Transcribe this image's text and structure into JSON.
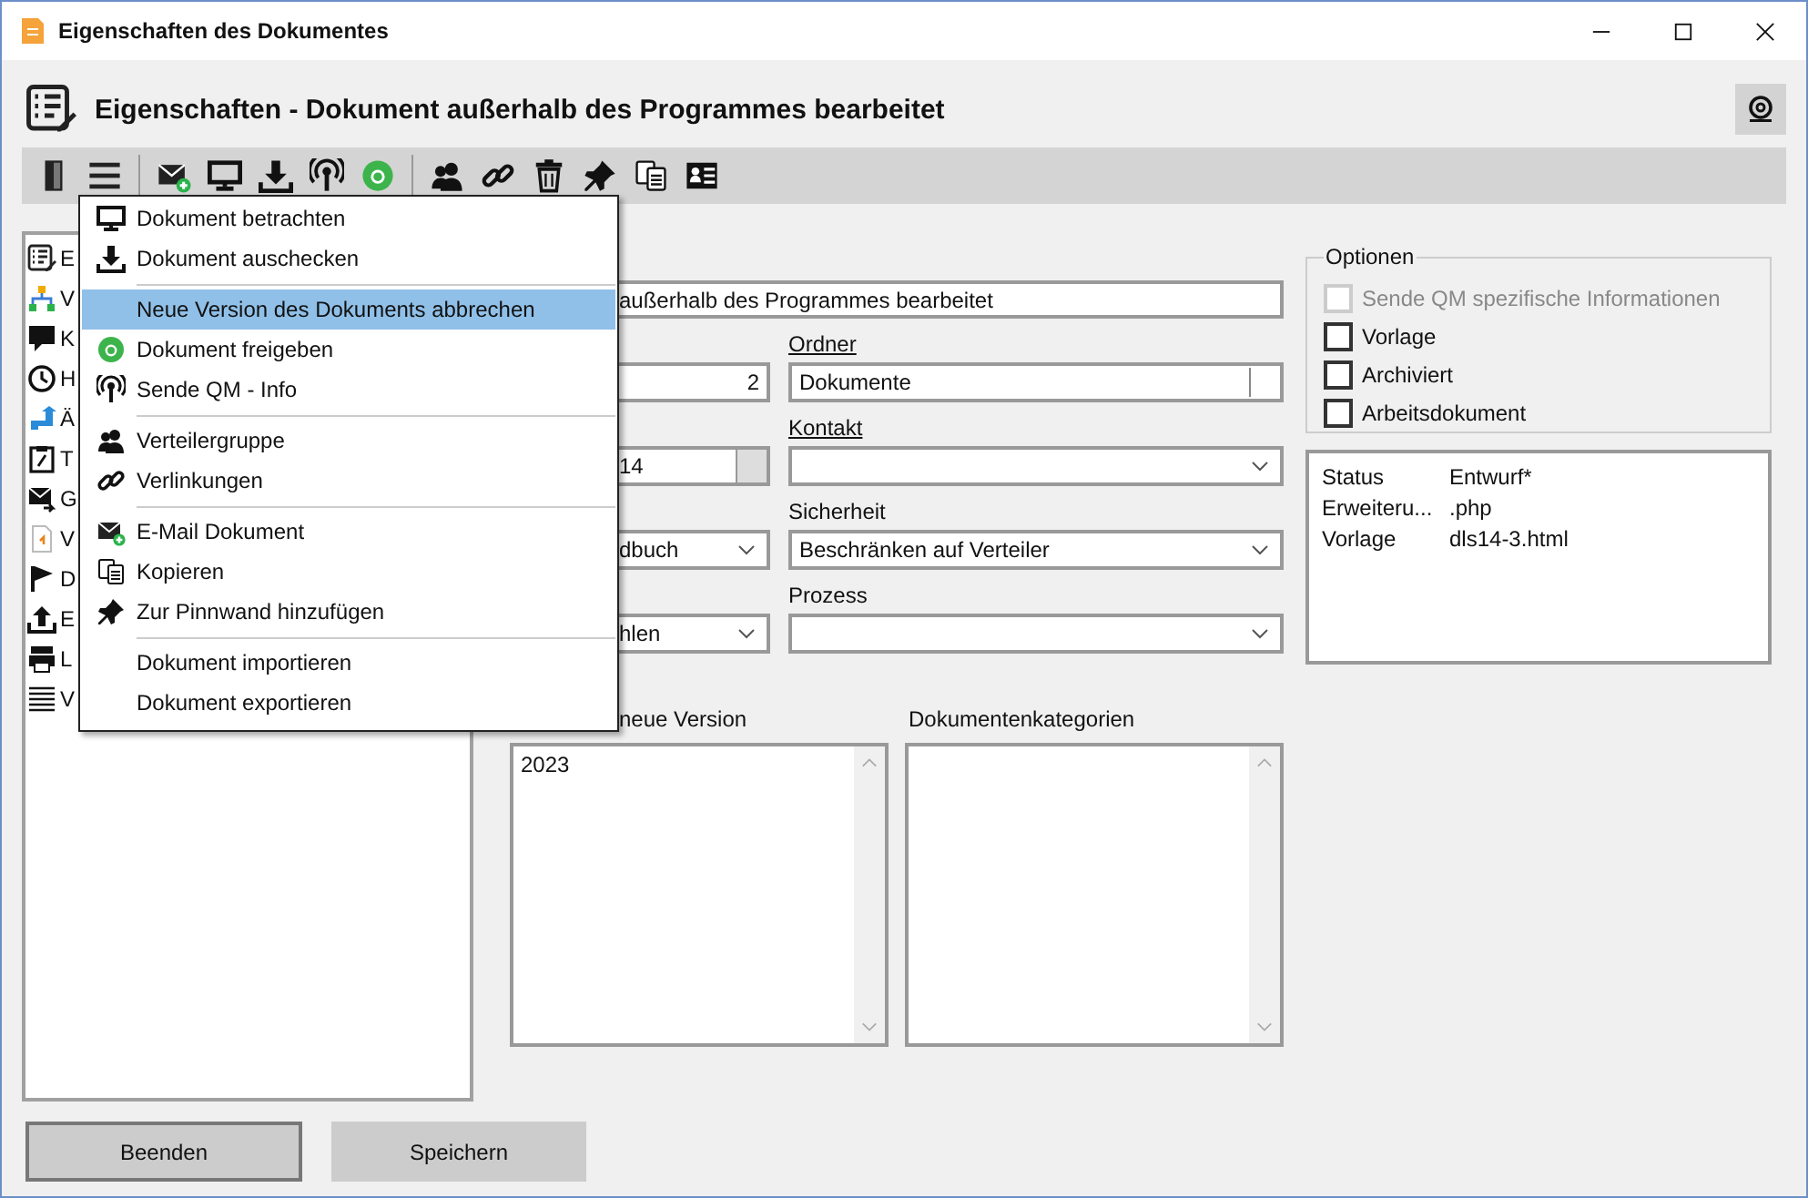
{
  "window": {
    "title": "Eigenschaften des Dokumentes"
  },
  "header": {
    "title": "Eigenschaften - Dokument außerhalb des Programmes bearbeitet"
  },
  "sidebar": {
    "items": [
      {
        "label": "E"
      },
      {
        "label": "V"
      },
      {
        "label": "K"
      },
      {
        "label": "H"
      },
      {
        "label": "Ä"
      },
      {
        "label": "T"
      },
      {
        "label": "G"
      },
      {
        "label": "V"
      },
      {
        "label": "D"
      },
      {
        "label": "E"
      },
      {
        "label": "L"
      },
      {
        "label": "V"
      }
    ]
  },
  "menu": {
    "groups": [
      [
        {
          "label": "Dokument betrachten",
          "selected": false
        },
        {
          "label": "Dokument auschecken",
          "selected": false
        }
      ],
      [
        {
          "label": "Neue Version des Dokuments abbrechen",
          "selected": true
        },
        {
          "label": "Dokument freigeben",
          "selected": false
        },
        {
          "label": "Sende QM - Info",
          "selected": false
        }
      ],
      [
        {
          "label": "Verteilergruppe",
          "selected": false
        },
        {
          "label": "Verlinkungen",
          "selected": false
        }
      ],
      [
        {
          "label": "E-Mail Dokument",
          "selected": false
        },
        {
          "label": "Kopieren",
          "selected": false
        },
        {
          "label": "Zur Pinnwand hinzufügen",
          "selected": false
        }
      ],
      [
        {
          "label": "Dokument importieren",
          "selected": false
        },
        {
          "label": "Dokument exportieren",
          "selected": false
        }
      ]
    ]
  },
  "form": {
    "title_field": {
      "value": "außerhalb des Programmes bearbeitet"
    },
    "rows": [
      {
        "left": {
          "kind": "number",
          "value": "2"
        },
        "right": {
          "label": "Ordner",
          "underlined": true,
          "kind": "text",
          "value": "Dokumente"
        }
      },
      {
        "left": {
          "kind": "date",
          "value": "14"
        },
        "right": {
          "label": "Kontakt",
          "underlined": true,
          "kind": "combo"
        }
      },
      {
        "left": {
          "kind": "combo",
          "value": "dbuch"
        },
        "right": {
          "label": "Sicherheit",
          "underlined": false,
          "kind": "combo",
          "value": "Beschränken auf Verteiler"
        }
      },
      {
        "left": {
          "kind": "combo",
          "value": "hlen"
        },
        "right": {
          "label": "Prozess",
          "underlined": false,
          "kind": "combo"
        }
      }
    ],
    "lists": [
      {
        "label": "neue Version",
        "items": [
          "2023"
        ]
      },
      {
        "label": "Dokumentenkategorien"
      }
    ]
  },
  "options": {
    "title": "Optionen",
    "checkboxes": [
      {
        "label": "Sende QM spezifische Informationen",
        "checked": false,
        "disabled": true
      },
      {
        "label": "Vorlage",
        "checked": false,
        "disabled": false
      },
      {
        "label": "Archiviert",
        "checked": false,
        "disabled": false
      },
      {
        "label": "Arbeitsdokument",
        "checked": false,
        "disabled": false
      }
    ]
  },
  "info": [
    {
      "key": "Status",
      "value": "Entwurf*"
    },
    {
      "key": "Erweiteru...",
      "value": ".php"
    },
    {
      "key": "Vorlage",
      "value": "dls14-3.html"
    }
  ],
  "buttons": [
    {
      "label": "Beenden",
      "focused": true
    },
    {
      "label": "Speichern",
      "focused": false
    }
  ]
}
